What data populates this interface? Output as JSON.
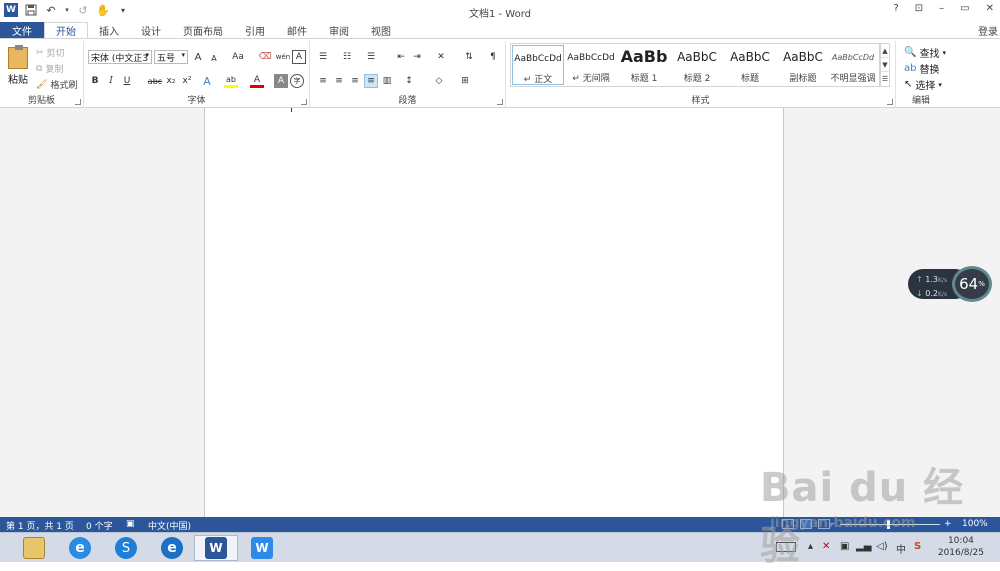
{
  "window": {
    "title": "文档1 - Word",
    "controls": [
      "?",
      "⊡",
      "–",
      "▭",
      "✕"
    ],
    "login": "登录"
  },
  "qat": {
    "logo": "W",
    "undo_label": "↶",
    "redo_label": "↺",
    "touch_label": "✋",
    "customize_label": "▾"
  },
  "tabs": [
    "文件",
    "开始",
    "插入",
    "设计",
    "页面布局",
    "引用",
    "邮件",
    "审阅",
    "视图"
  ],
  "active_tab": "开始",
  "ribbon": {
    "clipboard": {
      "label": "剪贴板",
      "paste": "粘贴",
      "cut": "剪切",
      "copy": "复制",
      "format_painter": "格式刷"
    },
    "font": {
      "label": "字体",
      "font_name": "宋体 (中文正3",
      "font_size": "五号",
      "grow": "A",
      "shrink": "A",
      "case": "Aa",
      "bold": "B",
      "italic": "I",
      "underline": "U",
      "strike": "abc",
      "sub": "x₂",
      "sup": "x²",
      "text_effect": "A",
      "highlight": "ab",
      "color": "A",
      "border_char": "A",
      "enclose": "字"
    },
    "paragraph": {
      "label": "段落"
    },
    "styles": {
      "label": "样式",
      "items": [
        {
          "preview": "AaBbCcDd",
          "name": "↵ 正文"
        },
        {
          "preview": "AaBbCcDd",
          "name": "↵ 无间隔"
        },
        {
          "preview": "AaBb",
          "name": "标题 1"
        },
        {
          "preview": "AaBbC",
          "name": "标题 2"
        },
        {
          "preview": "AaBbC",
          "name": "标题"
        },
        {
          "preview": "AaBbC",
          "name": "副标题"
        },
        {
          "preview": "AaBbCcDd",
          "name": "不明显强调"
        }
      ]
    },
    "editing": {
      "label": "编辑",
      "find": "查找",
      "replace": "替换",
      "select": "选择"
    }
  },
  "net_widget": {
    "up": "1.3",
    "up_unit": "K/s",
    "down": "0.2",
    "down_unit": "K/s",
    "percent": "64",
    "percent_unit": "%"
  },
  "status": {
    "page": "第 1 页，共 1 页",
    "words": "0 个字",
    "lang": "中文(中国)",
    "zoom": "100%"
  },
  "zoom_percent": 100,
  "taskbar": {
    "time": "10:04",
    "date": "2016/8/25"
  },
  "watermark": {
    "brand": "Bai du 经验",
    "url": "jingyan.baidu.com"
  }
}
